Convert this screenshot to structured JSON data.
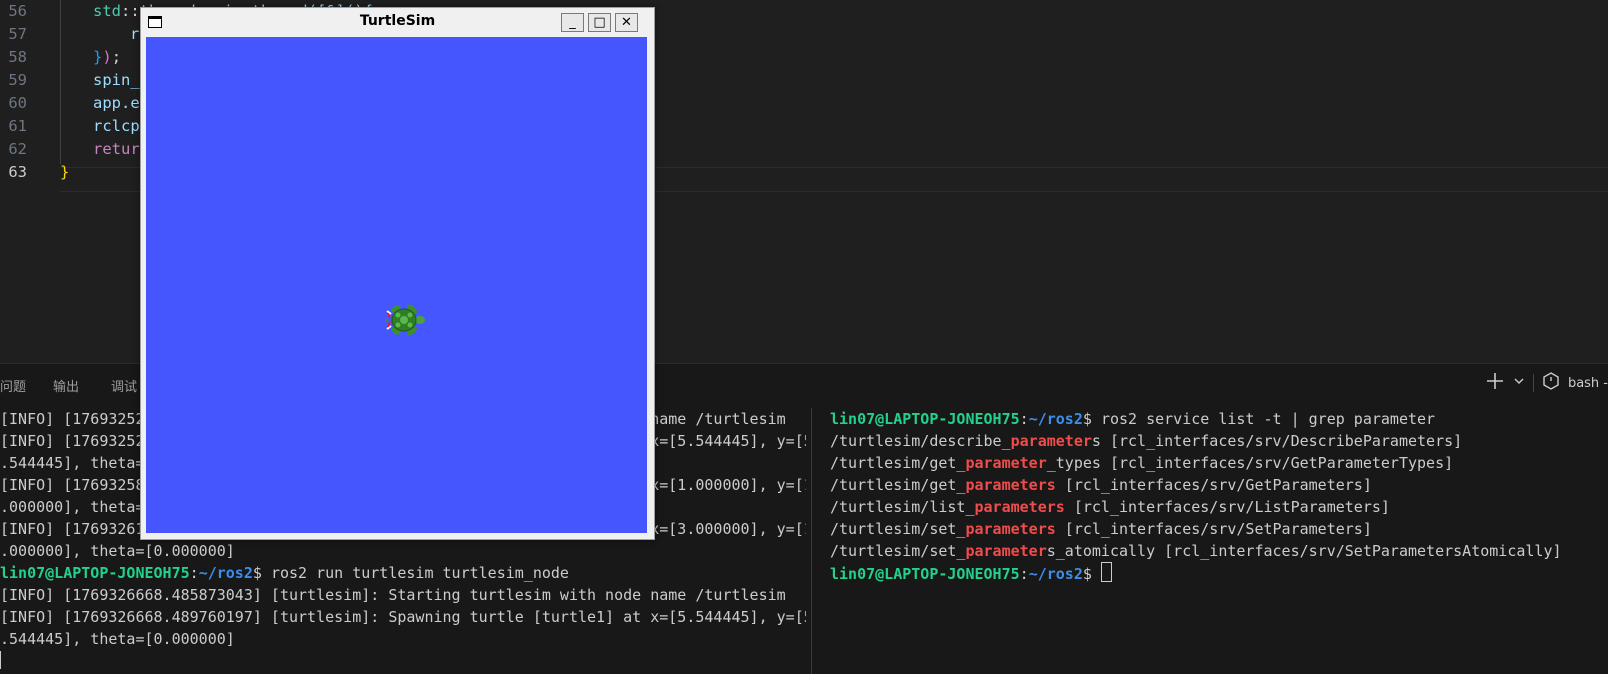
{
  "editor": {
    "lines": [
      {
        "num": "56",
        "tokens": [
          {
            "t": "std",
            "c": "t-ns"
          },
          {
            "t": "::",
            "c": "t-op"
          },
          {
            "t": "thread spin_thread([&](){",
            "c": "t-var"
          }
        ]
      },
      {
        "num": "57",
        "tokens": [
          {
            "t": "rclcpp::spin(node);",
            "c": "t-var"
          }
        ]
      },
      {
        "num": "58",
        "tokens": [
          {
            "t": "}",
            "c": "t-br3"
          },
          {
            "t": ")",
            "c": "t-br2"
          },
          {
            "t": ";",
            "c": "t-def"
          }
        ]
      },
      {
        "num": "59",
        "tokens": [
          {
            "t": "spin_thread.join();",
            "c": "t-var"
          }
        ]
      },
      {
        "num": "60",
        "tokens": [
          {
            "t": "app.exec();",
            "c": "t-var"
          }
        ]
      },
      {
        "num": "61",
        "tokens": [
          {
            "t": "rclcpp::shutdown();",
            "c": "t-var"
          }
        ]
      },
      {
        "num": "62",
        "tokens": [
          {
            "t": "return 0;",
            "c": "t-kw"
          }
        ]
      },
      {
        "num": "63",
        "tokens": [
          {
            "t": "}",
            "c": "t-br1"
          }
        ]
      }
    ]
  },
  "panel": {
    "tabs": [
      "问题",
      "输出",
      "调试"
    ],
    "shell_label": "bash -"
  },
  "term_left": [
    "[INFO] [1769325246.374614339] [turtlesim]: Starting turtlesim with node name /turtlesim",
    "[INFO] [1769325246.381524018] [turtlesim]: Spawning turtle [turtle1] at x=[5.544445], y=[5",
    ".544445], theta=[0.000000]",
    "[INFO] [1769325854.582013941] [turtlesim]: Spawning turtle [turtle2] at x=[1.000000], y=[1",
    ".000000], theta=[0.000000]",
    "[INFO] [1769326109.671200457] [turtlesim]: Spawning turtle [turtle3] at x=[3.000000], y=[1",
    ".000000], theta=[0.000000]"
  ],
  "term_left_prompt": {
    "user": "lin07@LAPTOP-JONEOH75",
    "path": "~/ros2",
    "cmd": "ros2 run turtlesim turtlesim_node"
  },
  "term_left_after": [
    "[INFO] [1769326668.485873043] [turtlesim]: Starting turtlesim with node name /turtlesim",
    "[INFO] [1769326668.489760197] [turtlesim]: Spawning turtle [turtle1] at x=[5.544445], y=[5",
    ".544445], theta=[0.000000]"
  ],
  "term_right": {
    "prompt1": {
      "user": "lin07@LAPTOP-JONEOH75",
      "path": "~/ros2",
      "cmd": "ros2 service list -t | grep parameter"
    },
    "services": [
      {
        "pre": "/turtlesim/describe_",
        "hl": "parameter",
        "post": "s [rcl_interfaces/srv/DescribeParameters]"
      },
      {
        "pre": "/turtlesim/get_",
        "hl": "parameter",
        "post": "_types [rcl_interfaces/srv/GetParameterTypes]"
      },
      {
        "pre": "/turtlesim/get_",
        "hl": "parameters",
        "post": " [rcl_interfaces/srv/GetParameters]"
      },
      {
        "pre": "/turtlesim/list_",
        "hl": "parameters",
        "post": " [rcl_interfaces/srv/ListParameters]"
      },
      {
        "pre": "/turtlesim/set_",
        "hl": "parameters",
        "post": " [rcl_interfaces/srv/SetParameters]"
      },
      {
        "pre": "/turtlesim/set_",
        "hl": "parameter",
        "post": "s_atomically [rcl_interfaces/srv/SetParametersAtomically]"
      }
    ],
    "prompt2": {
      "user": "lin07@LAPTOP-JONEOH75",
      "path": "~/ros2"
    }
  },
  "turtlesim": {
    "title": "TurtleSim",
    "minimize": "_",
    "maximize": "□",
    "close": "✕",
    "background": "#4556ff"
  }
}
